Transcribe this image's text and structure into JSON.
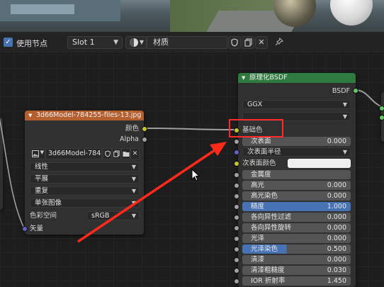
{
  "header": {
    "use_nodes_label": "使用节点",
    "slot_label": "Slot 1",
    "material_name": "材质",
    "icons": [
      "checkbox-checked",
      "material-sphere-icon",
      "shield-icon",
      "copy-icon",
      "close-icon",
      "pin-icon"
    ]
  },
  "image_node": {
    "title": "3d66Model-784255-files-13.jpg",
    "outputs": [
      "颜色",
      "Alpha"
    ],
    "image_name": "3d66Model-784...",
    "interpolation": "线性",
    "projection": "平展",
    "extension": "重复",
    "source": "单张图像",
    "color_space_label": "色彩空间",
    "color_space_value": "sRGB",
    "vector_input": "矢量",
    "header_color": "#b55f2e"
  },
  "bsdf_node": {
    "title": "原理化BSDF",
    "output": "BSDF",
    "distribution": "GGX",
    "subsurface_method": "",
    "base_color_label": "基础色",
    "subsurface_label": "次表面",
    "subsurface_value": "0.000",
    "subsurface_radius_label": "次表面半径",
    "subsurface_color_label": "次表面颜色",
    "params": [
      {
        "label": "金属度",
        "value": ""
      },
      {
        "label": "高光",
        "value": "0.000"
      },
      {
        "label": "高光染色",
        "value": "0.000"
      },
      {
        "label": "糙度",
        "value": "1.000"
      },
      {
        "label": "各向异性过滤",
        "value": "0.000"
      },
      {
        "label": "各向异性旋转",
        "value": "0.000"
      },
      {
        "label": "光泽",
        "value": "0.000"
      },
      {
        "label": "光泽染色",
        "value": "0.500"
      },
      {
        "label": "清漆",
        "value": "0.000"
      },
      {
        "label": "清漆粗糙度",
        "value": "0.030"
      },
      {
        "label": "IOR 折射率",
        "value": "1.450"
      }
    ],
    "header_color": "#2f7a3e"
  },
  "colors": {
    "highlight_box": "#ff2a2a",
    "arrow": "#ff2a1a",
    "accent": "#4772b3"
  }
}
